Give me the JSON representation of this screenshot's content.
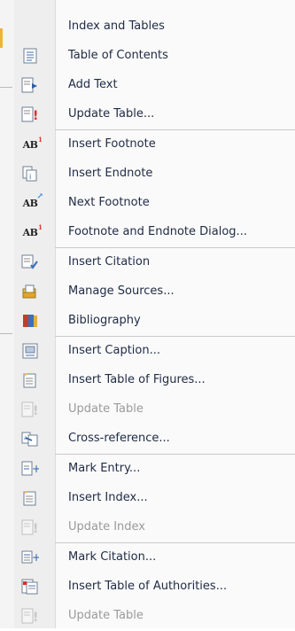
{
  "menu": {
    "items": [
      {
        "label": "Index and Tables",
        "icon": "none",
        "disabled": false
      },
      {
        "label": "Table of Contents",
        "icon": "table-of-contents-icon",
        "disabled": false
      },
      {
        "label": "Add Text",
        "icon": "add-text-icon",
        "disabled": false
      },
      {
        "label": "Update Table...",
        "icon": "update-table-icon",
        "disabled": false
      },
      {
        "label": "Insert Footnote",
        "icon": "insert-footnote-icon",
        "disabled": false
      },
      {
        "label": "Insert Endnote",
        "icon": "insert-endnote-icon",
        "disabled": false
      },
      {
        "label": "Next Footnote",
        "icon": "next-footnote-icon",
        "disabled": false
      },
      {
        "label": "Footnote and Endnote Dialog...",
        "icon": "footnote-dialog-icon",
        "disabled": false
      },
      {
        "label": "Insert Citation",
        "icon": "insert-citation-icon",
        "disabled": false
      },
      {
        "label": "Manage Sources...",
        "icon": "manage-sources-icon",
        "disabled": false
      },
      {
        "label": "Bibliography",
        "icon": "bibliography-icon",
        "disabled": false
      },
      {
        "label": "Insert Caption...",
        "icon": "insert-caption-icon",
        "disabled": false
      },
      {
        "label": "Insert Table of Figures...",
        "icon": "table-of-figures-icon",
        "disabled": false
      },
      {
        "label": "Update Table",
        "icon": "update-table-icon",
        "disabled": true
      },
      {
        "label": "Cross-reference...",
        "icon": "cross-reference-icon",
        "disabled": false
      },
      {
        "label": "Mark Entry...",
        "icon": "mark-entry-icon",
        "disabled": false
      },
      {
        "label": "Insert Index...",
        "icon": "insert-index-icon",
        "disabled": false
      },
      {
        "label": "Update Index",
        "icon": "update-index-icon",
        "disabled": true
      },
      {
        "label": "Mark Citation...",
        "icon": "mark-citation-icon",
        "disabled": false
      },
      {
        "label": "Insert Table of Authorities...",
        "icon": "table-of-authorities-icon",
        "disabled": false
      },
      {
        "label": "Update Table",
        "icon": "update-table-icon",
        "disabled": true
      }
    ]
  },
  "colors": {
    "text": "#1f2a44",
    "disabled_text": "#9a9a9a",
    "accent": "#f2b233",
    "footnote_mark": "#d8392b"
  }
}
